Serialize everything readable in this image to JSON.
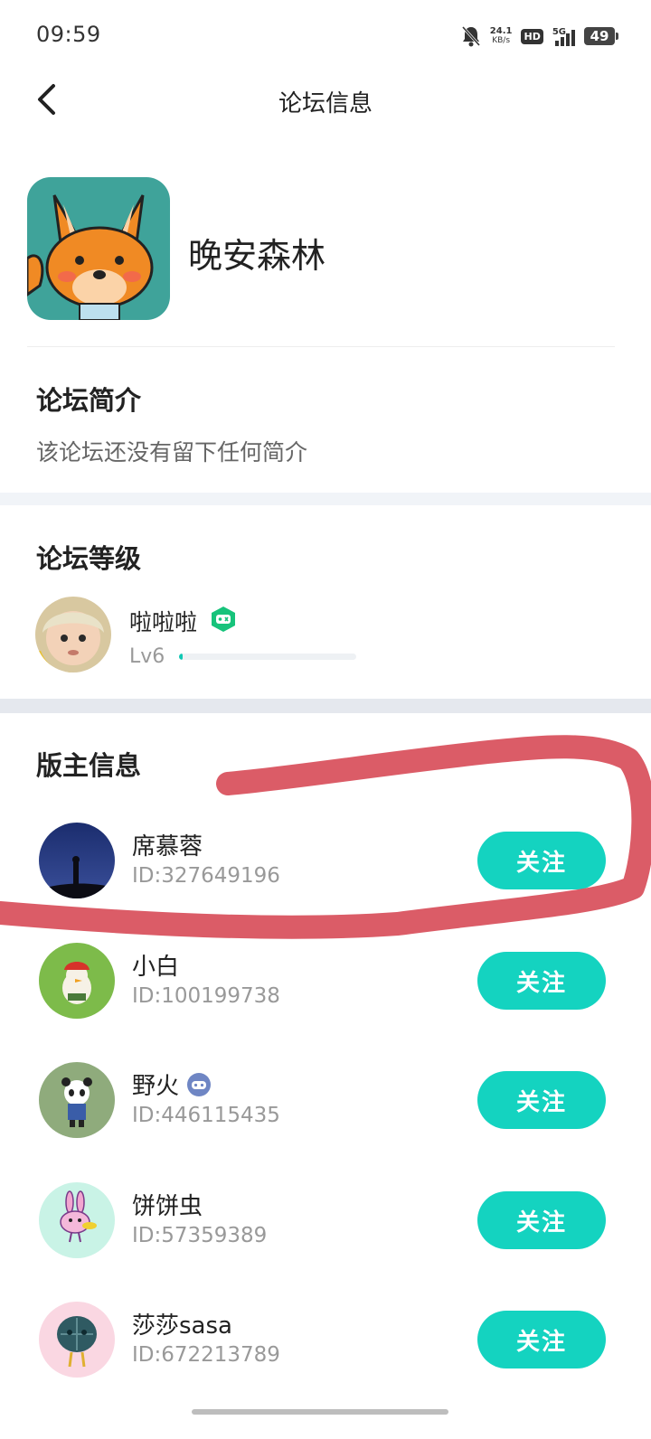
{
  "status_bar": {
    "time": "09:59",
    "net_speed_value": "24.1",
    "net_speed_unit": "KB/s",
    "hd_label": "HD",
    "network_label": "5G",
    "battery": "49",
    "icons": [
      "bell-muted-icon",
      "hd-icon",
      "signal-icon",
      "battery-icon"
    ]
  },
  "nav": {
    "title": "论坛信息",
    "back_icon": "chevron-left-icon"
  },
  "forum": {
    "name": "晚安森林",
    "intro_title": "论坛简介",
    "intro_text": "该论坛还没有留下任何简介"
  },
  "level": {
    "title": "论坛等级",
    "user_name": "啦啦啦",
    "level_label": "Lv6",
    "progress": 0.02
  },
  "moderators": {
    "title": "版主信息",
    "follow_label": "关注",
    "items": [
      {
        "name": "席慕蓉",
        "id": "ID:327649196"
      },
      {
        "name": "小白",
        "id": "ID:100199738"
      },
      {
        "name": "野火",
        "id": "ID:446115435"
      },
      {
        "name": "饼饼虫",
        "id": "ID:57359389"
      },
      {
        "name": "莎莎sasa",
        "id": "ID:672213789"
      }
    ]
  },
  "colors": {
    "accent": "#14d3c0",
    "annotation": "#d9535f"
  }
}
